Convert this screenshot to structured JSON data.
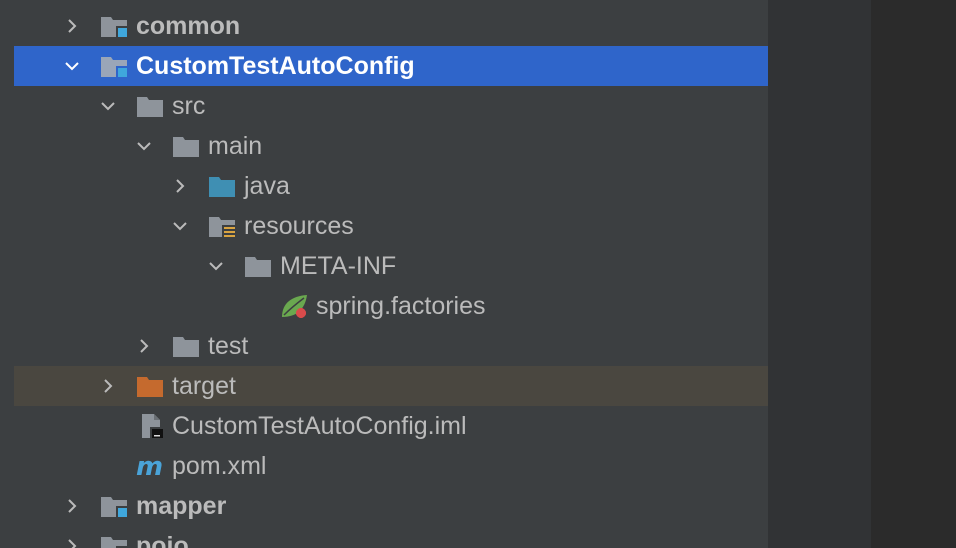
{
  "tree": {
    "rows": [
      {
        "label": "common",
        "kind": "module",
        "bold": true,
        "expanded": false
      },
      {
        "label": "CustomTestAutoConfig",
        "kind": "module",
        "bold": true,
        "expanded": true,
        "selected": true
      },
      {
        "label": "src",
        "kind": "folder",
        "expanded": true
      },
      {
        "label": "main",
        "kind": "folder",
        "expanded": true
      },
      {
        "label": "java",
        "kind": "source-folder",
        "expanded": false
      },
      {
        "label": "resources",
        "kind": "resources-folder",
        "expanded": true
      },
      {
        "label": "META-INF",
        "kind": "folder",
        "expanded": true
      },
      {
        "label": "spring.factories",
        "kind": "spring-file"
      },
      {
        "label": "test",
        "kind": "folder",
        "expanded": false
      },
      {
        "label": "target",
        "kind": "excluded-folder",
        "expanded": false
      },
      {
        "label": "CustomTestAutoConfig.iml",
        "kind": "iml-file"
      },
      {
        "label": "pom.xml",
        "kind": "maven-file"
      },
      {
        "label": "mapper",
        "kind": "module",
        "bold": true,
        "expanded": false
      },
      {
        "label": "pojo",
        "kind": "module",
        "bold": true,
        "expanded": false
      }
    ]
  },
  "colors": {
    "selection": "#2f65ca",
    "excluded_row": "#4a4740",
    "folder": "#8e949b",
    "source_folder": "#3f8fb3",
    "excluded_folder": "#c56a2e",
    "module_badge": "#3fa7dc",
    "maven": "#4aa3d8",
    "spring": "#6aa84f"
  }
}
